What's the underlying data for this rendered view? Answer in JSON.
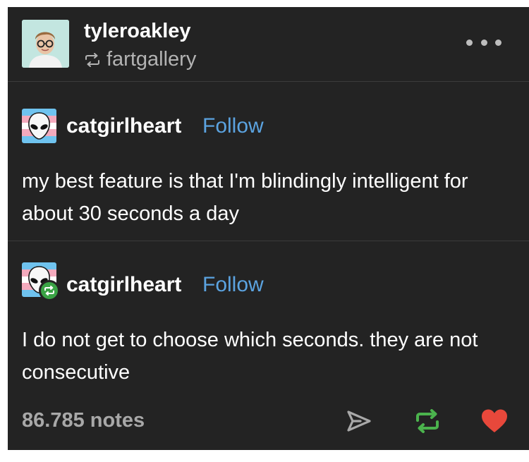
{
  "header": {
    "blog_name": "tyleroakley",
    "reblogged_from": "fartgallery",
    "more_label": "more-options"
  },
  "posts": [
    {
      "username": "catgirlheart",
      "follow_label": "Follow",
      "text": "my best feature is that I'm blindingly intelligent for about 30 seconds a day",
      "is_reblog": false
    },
    {
      "username": "catgirlheart",
      "follow_label": "Follow",
      "text": "I do not get to choose which seconds. they are not consecutive",
      "is_reblog": true
    }
  ],
  "footer": {
    "notes": "86.785 notes",
    "icons": [
      "share-icon",
      "reblog-icon",
      "heart-icon"
    ]
  },
  "colors": {
    "background": "#232323",
    "follow": "#5ba3e0",
    "reblog": "#3aa345",
    "heart": "#e8483b",
    "muted": "#a8a8a8"
  }
}
